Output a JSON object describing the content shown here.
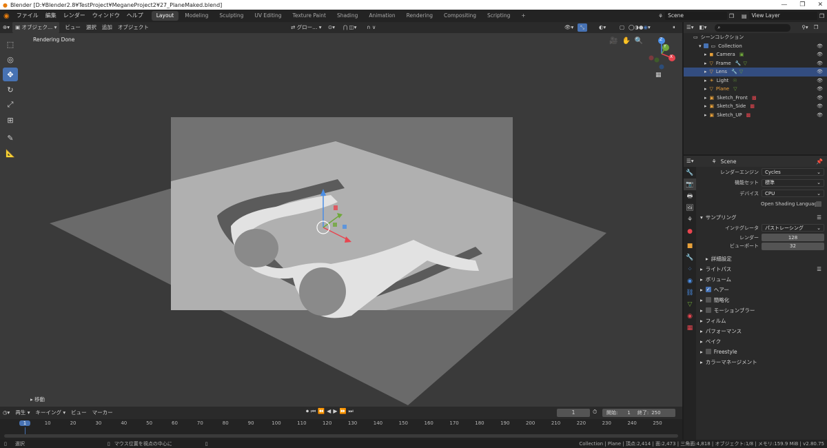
{
  "window": {
    "title": "Blender [D:¥Blender2.8¥TestProject¥MeganeProject2¥27_PlaneMaked.blend]",
    "controls": [
      "—",
      "❐",
      "✕"
    ]
  },
  "menubar": {
    "menus": [
      "ファイル",
      "編集",
      "レンダー",
      "ウィンドウ",
      "ヘルプ"
    ],
    "workspaces": [
      "Layout",
      "Modeling",
      "Sculpting",
      "UV Editing",
      "Texture Paint",
      "Shading",
      "Animation",
      "Rendering",
      "Compositing",
      "Scripting"
    ],
    "active_workspace": "Layout",
    "add_tab": "+",
    "scene_name": "Scene",
    "view_layer": "View Layer"
  },
  "viewport_header": {
    "mode": "オブジェク...",
    "menus": [
      "ビュー",
      "選択",
      "追加",
      "オブジェクト"
    ],
    "transform_orientation": "グロー...",
    "snap_label": "∩ ∨"
  },
  "viewport": {
    "status_text": "Rendering Done",
    "last_operator": "移動",
    "gizmo_axes": {
      "x": "X",
      "y": "Y",
      "z": "Z"
    },
    "colors": {
      "background": "#3a3a3a",
      "plane": "#6a6a6a",
      "camera_frame": "#8a8a8a",
      "gizmo_x": "#e8454f",
      "gizmo_y": "#6fa83a",
      "gizmo_z": "#4a8ee6"
    }
  },
  "toolbar": {
    "tools": [
      "select-box",
      "cursor",
      "move",
      "rotate",
      "scale",
      "transform",
      "annotate",
      "measure"
    ],
    "active_tool": "move"
  },
  "timeline": {
    "menus": [
      "再生",
      "キーイング",
      "ビュー",
      "マーカー"
    ],
    "current_frame": "1",
    "start_label": "開始:",
    "start": "1",
    "end_label": "終了:",
    "end": "250",
    "ruler_marks": [
      "1",
      "10",
      "20",
      "30",
      "40",
      "50",
      "60",
      "70",
      "80",
      "90",
      "100",
      "110",
      "120",
      "130",
      "140",
      "150",
      "160",
      "170",
      "180",
      "190",
      "200",
      "210",
      "220",
      "230",
      "240",
      "250"
    ]
  },
  "statusbar": {
    "left_action": "選択",
    "middle_action": "マウス位置を視点の中心に",
    "stats": "Collection | Plane | 頂点:2,414 | 面:2,473 | 三角面:4,818 | オブジェクト:1/8 | メモリ:159.9 MiB | v2.80.75"
  },
  "outliner": {
    "root": "シーンコレクション",
    "collection": "Collection",
    "items": [
      {
        "name": "Camera",
        "type": "camera",
        "selected": false,
        "active": false
      },
      {
        "name": "Frame",
        "type": "mesh",
        "selected": false,
        "active": false
      },
      {
        "name": "Lens",
        "type": "mesh",
        "selected": true,
        "active": false
      },
      {
        "name": "Light",
        "type": "light",
        "selected": false,
        "active": false
      },
      {
        "name": "Plane",
        "type": "mesh",
        "selected": false,
        "active": true
      },
      {
        "name": "Sketch_Front",
        "type": "image",
        "selected": false,
        "active": false
      },
      {
        "name": "Sketch_Side",
        "type": "image",
        "selected": false,
        "active": false
      },
      {
        "name": "Sketch_UP",
        "type": "image",
        "selected": false,
        "active": false
      }
    ],
    "search_placeholder": "⌕"
  },
  "properties": {
    "context": "Scene",
    "render_engine_label": "レンダーエンジン",
    "render_engine": "Cycles",
    "feature_set_label": "機能セット",
    "feature_set": "標準",
    "device_label": "デバイス",
    "device": "CPU",
    "osl_label": "Open Shading Language",
    "sampling_label": "サンプリング",
    "integrator_label": "インテグレータ",
    "integrator": "パストレーシング",
    "render_label": "レンダー",
    "render_samples": "128",
    "viewport_label": "ビューポート",
    "viewport_samples": "32",
    "advanced_label": "詳細設定",
    "sections": [
      {
        "label": "ライトパス",
        "checkbox": false,
        "checked": false
      },
      {
        "label": "ボリューム",
        "checkbox": false,
        "checked": false
      },
      {
        "label": "ヘアー",
        "checkbox": true,
        "checked": true
      },
      {
        "label": "簡略化",
        "checkbox": true,
        "checked": false
      },
      {
        "label": "モーションブラー",
        "checkbox": true,
        "checked": false
      },
      {
        "label": "フィルム",
        "checkbox": false,
        "checked": false
      },
      {
        "label": "パフォーマンス",
        "checkbox": false,
        "checked": false
      },
      {
        "label": "ベイク",
        "checkbox": false,
        "checked": false
      },
      {
        "label": "Freestyle",
        "checkbox": true,
        "checked": false
      },
      {
        "label": "カラーマネージメント",
        "checkbox": false,
        "checked": false
      }
    ]
  }
}
